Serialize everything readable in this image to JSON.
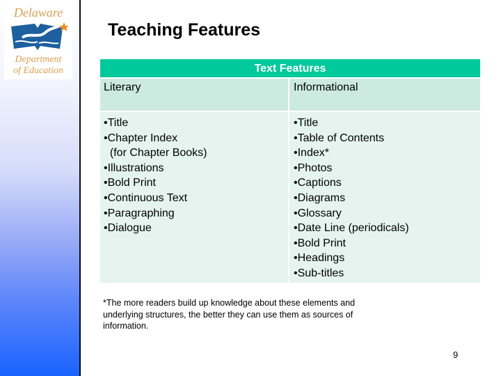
{
  "logo": {
    "top_text": "Delaware",
    "bottom_line1": "Department",
    "bottom_line2": "of Education",
    "icon": "open-book-star-icon",
    "colors": {
      "text": "#d9a052",
      "book": "#1d5f9f",
      "star": "#f08a24"
    }
  },
  "slide": {
    "title": "Teaching Features",
    "page_number": "9"
  },
  "table": {
    "header": "Text Features",
    "columns": [
      "Literary",
      "Informational"
    ],
    "literary_items": [
      "•Title",
      "•Chapter Index",
      "  (for Chapter Books)",
      "•Illustrations",
      "•Bold Print",
      "•Continuous Text",
      "•Paragraphing",
      "•Dialogue"
    ],
    "informational_items": [
      "•Title",
      "•Table of Contents",
      "•Index*",
      "•Photos",
      "•Captions",
      "•Diagrams",
      "•Glossary",
      "•Date Line (periodicals)",
      "•Bold Print",
      "•Headings",
      "•Sub-titles"
    ],
    "colors": {
      "header_bg": "#00c99c",
      "head_row_bg": "#cceadf",
      "body_row_bg": "#e5f4ee"
    }
  },
  "footnote": "*The more readers build up knowledge about these elements and underlying structures, the better they can use them as sources of information."
}
